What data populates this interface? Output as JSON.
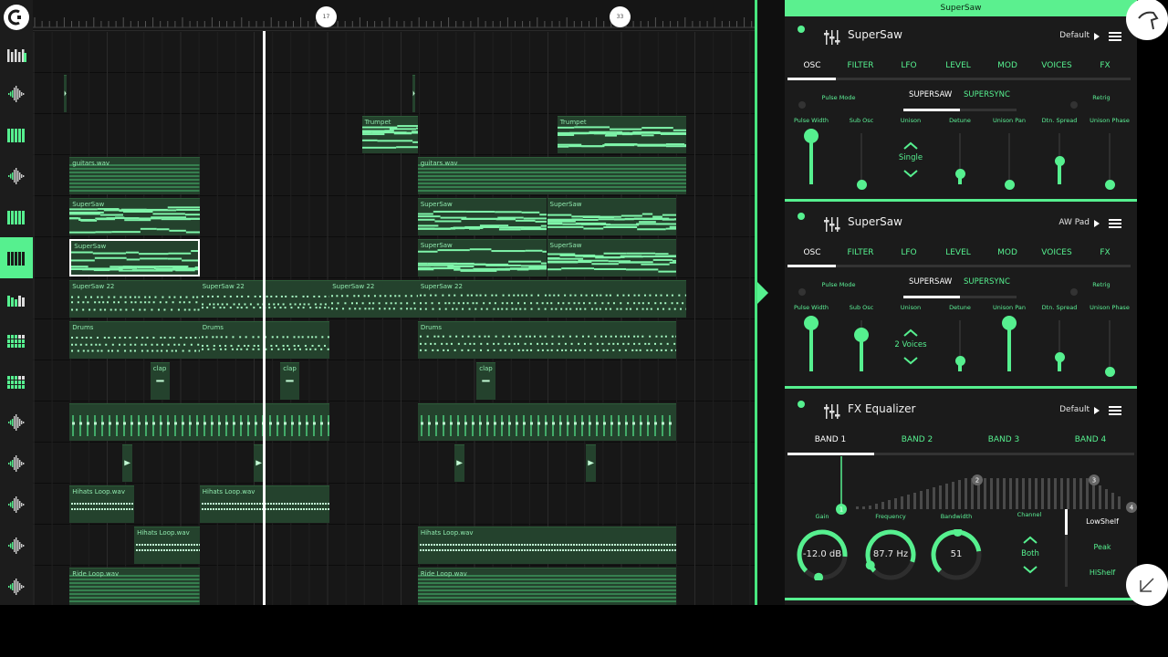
{
  "timeline": {
    "markers": [
      "17",
      "33"
    ],
    "tracks": [
      {
        "icon": "mixer-icon"
      },
      {
        "icon": "waveform-icon",
        "clips": [
          {
            "name": "",
            "s": 0.42,
            "e": 0.46,
            "k": "blip"
          },
          {
            "name": "",
            "s": 5.17,
            "e": 5.21,
            "k": "blip"
          }
        ]
      },
      {
        "icon": "keyboard-icon",
        "clips": [
          {
            "name": "Trumpet",
            "s": 4.48,
            "e": 5.24,
            "k": "notes"
          },
          {
            "name": "Trumpet",
            "s": 7.14,
            "e": 8.9,
            "k": "notes"
          }
        ]
      },
      {
        "icon": "waveform-icon",
        "clips": [
          {
            "name": "guitars.wav",
            "s": 0.5,
            "e": 2.27,
            "k": "wave"
          },
          {
            "name": "guitars.wav",
            "s": 5.24,
            "e": 8.9,
            "k": "wave"
          }
        ]
      },
      {
        "icon": "keyboard-icon",
        "clips": [
          {
            "name": "SuperSaw",
            "s": 0.5,
            "e": 2.27,
            "k": "notes"
          },
          {
            "name": "SuperSaw",
            "s": 5.24,
            "e": 7.0,
            "k": "notes"
          },
          {
            "name": "SuperSaw",
            "s": 7.0,
            "e": 8.76,
            "k": "notes"
          }
        ]
      },
      {
        "icon": "keyboard-icon",
        "selected": true,
        "clips": [
          {
            "name": "SuperSaw",
            "s": 0.5,
            "e": 2.27,
            "k": "notes",
            "selected": true
          },
          {
            "name": "SuperSaw",
            "s": 5.24,
            "e": 7.0,
            "k": "notes"
          },
          {
            "name": "SuperSaw",
            "s": 7.0,
            "e": 8.76,
            "k": "notes"
          }
        ]
      },
      {
        "icon": "keyboard-bars-icon",
        "clips": [
          {
            "name": "SuperSaw 22",
            "s": 0.5,
            "e": 2.27,
            "k": "dots"
          },
          {
            "name": "SuperSaw 22",
            "s": 2.27,
            "e": 4.04,
            "k": "dots"
          },
          {
            "name": "SuperSaw 22",
            "s": 4.04,
            "e": 5.24,
            "k": "dots"
          },
          {
            "name": "SuperSaw 22",
            "s": 5.24,
            "e": 8.9,
            "k": "dots"
          }
        ]
      },
      {
        "icon": "drum-pads-icon",
        "clips": [
          {
            "name": "Drums",
            "s": 0.5,
            "e": 2.27,
            "k": "dots"
          },
          {
            "name": "Drums",
            "s": 2.27,
            "e": 4.04,
            "k": "dots"
          },
          {
            "name": "Drums",
            "s": 5.24,
            "e": 8.76,
            "k": "dots"
          }
        ]
      },
      {
        "icon": "drum-pads-icon",
        "clips": [
          {
            "name": "clap",
            "s": 1.6,
            "e": 1.86,
            "k": "dash"
          },
          {
            "name": "clap",
            "s": 3.37,
            "e": 3.63,
            "k": "dash"
          },
          {
            "name": "clap",
            "s": 6.04,
            "e": 6.3,
            "k": "dash"
          }
        ]
      },
      {
        "icon": "waveform-icon",
        "clips": [
          {
            "name": "",
            "s": 0.5,
            "e": 4.04,
            "k": "ticks"
          },
          {
            "name": "",
            "s": 5.24,
            "e": 8.76,
            "k": "ticks"
          }
        ]
      },
      {
        "icon": "waveform-icon",
        "clips": [
          {
            "name": "",
            "s": 1.22,
            "e": 1.36,
            "k": "blip"
          },
          {
            "name": "",
            "s": 3.0,
            "e": 3.14,
            "k": "blip"
          },
          {
            "name": "",
            "s": 5.74,
            "e": 5.88,
            "k": "blip"
          },
          {
            "name": "",
            "s": 7.53,
            "e": 7.67,
            "k": "blip"
          }
        ]
      },
      {
        "icon": "waveform-icon",
        "clips": [
          {
            "name": "Hihats Loop.wav",
            "s": 0.5,
            "e": 1.38,
            "k": "hats"
          },
          {
            "name": "Hihats Loop.wav",
            "s": 2.27,
            "e": 4.04,
            "k": "hats"
          }
        ]
      },
      {
        "icon": "waveform-icon",
        "clips": [
          {
            "name": "Hihats Loop.wav",
            "s": 1.38,
            "e": 2.27,
            "k": "hats"
          },
          {
            "name": "Hihats Loop.wav",
            "s": 5.24,
            "e": 8.76,
            "k": "hats"
          }
        ]
      },
      {
        "icon": "waveform-icon",
        "clips": [
          {
            "name": "Ride Loop.wav",
            "s": 0.5,
            "e": 2.27,
            "k": "wave"
          },
          {
            "name": "Ride Loop.wav",
            "s": 5.24,
            "e": 8.76,
            "k": "wave"
          }
        ]
      }
    ]
  },
  "panel": {
    "title": "SuperSaw",
    "synth1": {
      "name": "SuperSaw",
      "preset": "Default",
      "tabs": [
        "OSC",
        "FILTER",
        "LFO",
        "LEVEL",
        "MOD",
        "VOICES",
        "FX"
      ],
      "pulse_mode": "Pulse Mode",
      "supersaw": "SUPERSAW",
      "supersync": "SUPERSYNC",
      "retrig": "Retrig",
      "params": [
        "Pulse Width",
        "Sub Osc",
        "Unison",
        "Detune",
        "Unison Pan",
        "Dtn. Spread",
        "Unison Phase"
      ],
      "levels": [
        0.95,
        0.0,
        null,
        0.2,
        0.0,
        0.46,
        0.0
      ],
      "unison_value": "Single"
    },
    "synth2": {
      "name": "SuperSaw",
      "preset": "AW Pad",
      "tabs": [
        "OSC",
        "FILTER",
        "LFO",
        "LEVEL",
        "MOD",
        "VOICES",
        "FX"
      ],
      "pulse_mode": "Pulse Mode",
      "supersaw": "SUPERSAW",
      "supersync": "SUPERSYNC",
      "retrig": "Retrig",
      "params": [
        "Pulse Width",
        "Sub Osc",
        "Unison",
        "Detune",
        "Unison Pan",
        "Dtn. Spread",
        "Unison Phase"
      ],
      "levels": [
        0.95,
        0.72,
        null,
        0.2,
        0.95,
        0.27,
        0.0
      ],
      "unison_value": "2 Voices"
    },
    "eq": {
      "name": "FX Equalizer",
      "preset": "Default",
      "bands": [
        "BAND 1",
        "BAND 2",
        "BAND 3",
        "BAND 4"
      ],
      "band_markers": [
        "1",
        "2",
        "3",
        "4"
      ],
      "knobs": [
        {
          "label": "Gain",
          "value": "-12.0 dB"
        },
        {
          "label": "Frequency",
          "value": "87.7 Hz"
        },
        {
          "label": "Bandwidth",
          "value": "51"
        }
      ],
      "channel_label": "Channel",
      "channel_value": "Both",
      "types": [
        "LowShelf",
        "Peak",
        "HiShelf"
      ]
    }
  },
  "colors": {
    "accent": "#56f08f",
    "clip": "#24422d",
    "background": "#171717"
  }
}
